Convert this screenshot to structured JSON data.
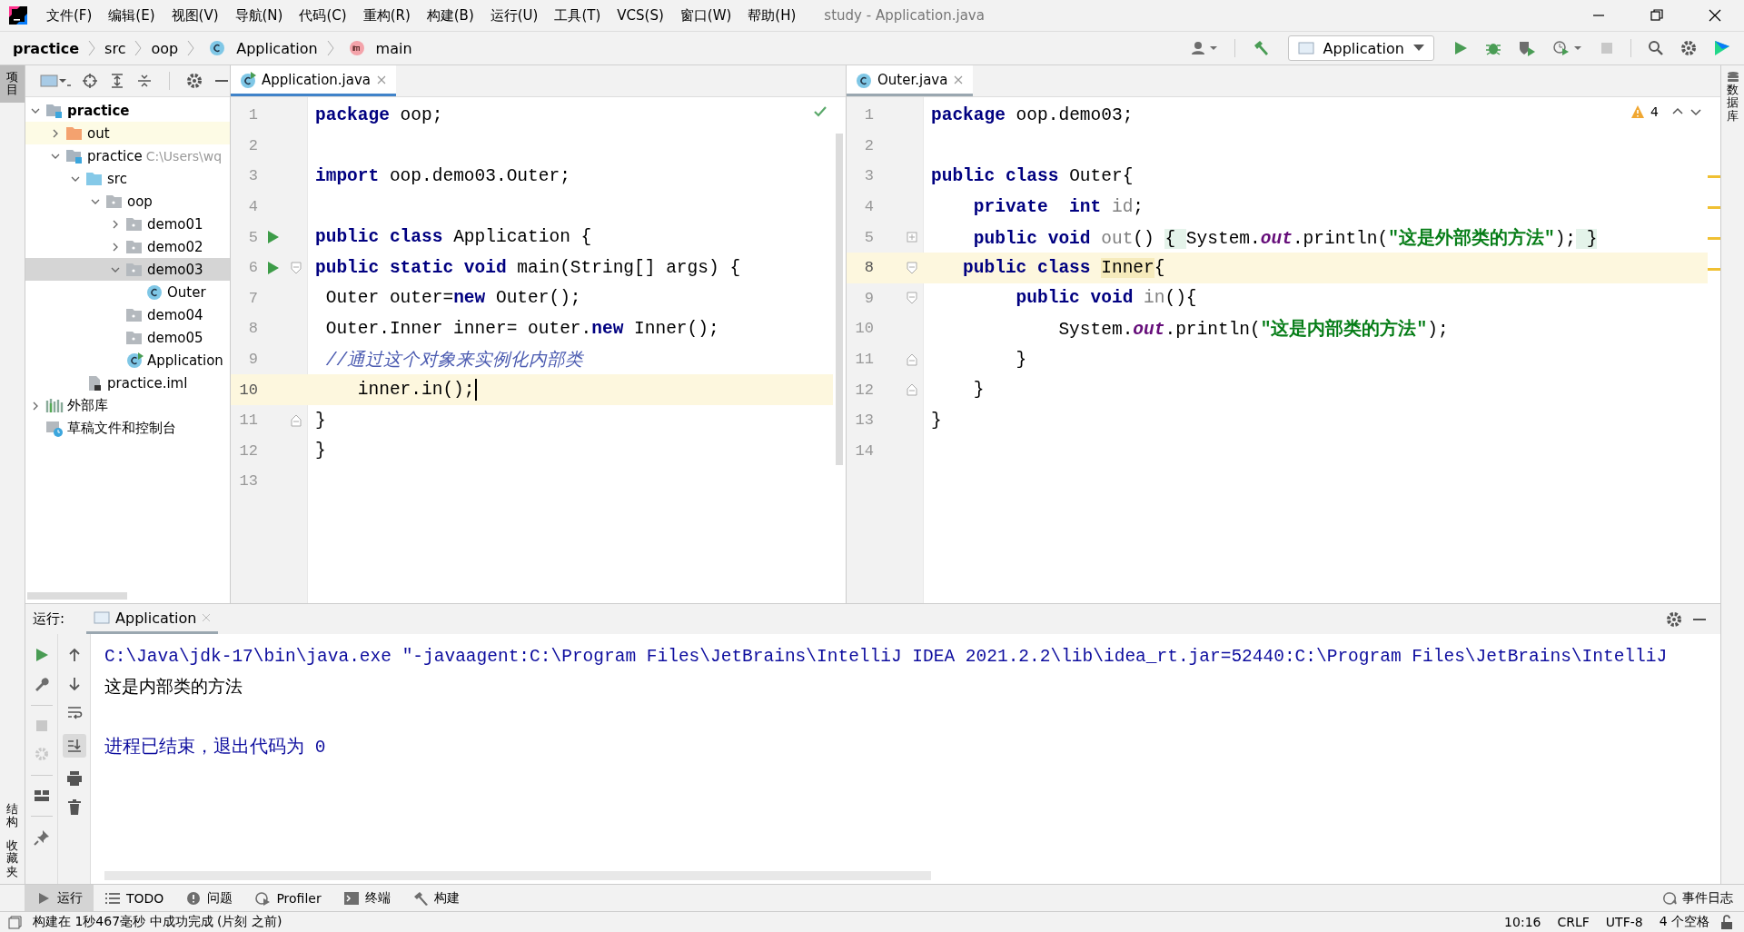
{
  "window": {
    "title": "study - Application.java"
  },
  "menu": [
    "文件(F)",
    "编辑(E)",
    "视图(V)",
    "导航(N)",
    "代码(C)",
    "重构(R)",
    "构建(B)",
    "运行(U)",
    "工具(T)",
    "VCS(S)",
    "窗口(W)",
    "帮助(H)"
  ],
  "breadcrumbs": [
    {
      "label": "practice",
      "kind": "project"
    },
    {
      "label": "src",
      "kind": "folder"
    },
    {
      "label": "oop",
      "kind": "folder"
    },
    {
      "label": "Application",
      "kind": "class"
    },
    {
      "label": "main",
      "kind": "method"
    }
  ],
  "run_config": {
    "label": "Application"
  },
  "left_stripe": [
    {
      "label": "项目",
      "selected": true
    },
    {
      "label": "结构",
      "selected": false
    },
    {
      "label": "收藏夹",
      "selected": false
    }
  ],
  "right_stripe": [
    {
      "label": "数据库",
      "selected": false
    }
  ],
  "project_tree": [
    {
      "label": "practice",
      "kind": "module",
      "bold": true,
      "expanded": true,
      "selected": false,
      "children": [
        {
          "label": "out",
          "kind": "excluded",
          "expanded": false,
          "selected": false
        },
        {
          "label": "practice",
          "hint": "C:\\Users\\wq",
          "kind": "module",
          "expanded": true,
          "selected": false,
          "children": [
            {
              "label": "src",
              "kind": "source",
              "expanded": true,
              "selected": false,
              "children": [
                {
                  "label": "oop",
                  "kind": "package",
                  "expanded": true,
                  "selected": false,
                  "children": [
                    {
                      "label": "demo01",
                      "kind": "package",
                      "expanded": false,
                      "selected": false
                    },
                    {
                      "label": "demo02",
                      "kind": "package",
                      "expanded": false,
                      "selected": false
                    },
                    {
                      "label": "demo03",
                      "kind": "package",
                      "expanded": true,
                      "selected": true,
                      "children": [
                        {
                          "label": "Outer",
                          "kind": "class",
                          "selected": false
                        }
                      ]
                    },
                    {
                      "label": "demo04",
                      "kind": "package",
                      "selected": false
                    },
                    {
                      "label": "demo05",
                      "kind": "package",
                      "selected": false
                    },
                    {
                      "label": "Application",
                      "kind": "runclass",
                      "selected": false
                    }
                  ]
                }
              ]
            },
            {
              "label": "practice.iml",
              "kind": "file",
              "selected": false
            }
          ]
        }
      ]
    },
    {
      "label": "外部库",
      "kind": "library",
      "expanded": false,
      "selected": false
    },
    {
      "label": "草稿文件和控制台",
      "kind": "scratch",
      "selected": false
    }
  ],
  "editors": [
    {
      "tab": "Application.java",
      "focused": true,
      "kind": "clean",
      "lines": [
        {
          "number": "1",
          "run": false,
          "current": false,
          "kind": "plain",
          "tokens": [
            {
              "kind": "keyword",
              "text": "package"
            },
            {
              "kind": "plain",
              "text": " oop;"
            }
          ]
        },
        {
          "number": "2",
          "run": false,
          "current": false,
          "kind": "plain"
        },
        {
          "number": "3",
          "run": false,
          "current": false,
          "kind": "plain",
          "tokens": [
            {
              "kind": "keyword",
              "text": "import"
            },
            {
              "kind": "plain",
              "text": " oop.demo03.Outer;"
            }
          ]
        },
        {
          "number": "4",
          "run": false,
          "current": false,
          "kind": "plain"
        },
        {
          "number": "5",
          "run": true,
          "current": false,
          "kind": "plain",
          "tokens": [
            {
              "kind": "keyword",
              "text": "public class"
            },
            {
              "kind": "plain",
              "text": " Application {"
            }
          ]
        },
        {
          "number": "6",
          "run": true,
          "current": false,
          "kind": "fold-open",
          "tokens": [
            {
              "kind": "keyword",
              "text": "public static void"
            },
            {
              "kind": "plain",
              "text": " main(String[] args) {"
            }
          ]
        },
        {
          "number": "7",
          "run": false,
          "current": false,
          "kind": "plain",
          "tokens": [
            {
              "kind": "plain",
              "text": " Outer outer="
            },
            {
              "kind": "keyword",
              "text": "new"
            },
            {
              "kind": "plain",
              "text": " Outer();"
            }
          ]
        },
        {
          "number": "8",
          "run": false,
          "current": false,
          "kind": "plain",
          "tokens": [
            {
              "kind": "plain",
              "text": " Outer.Inner inner= outer."
            },
            {
              "kind": "keyword",
              "text": "new"
            },
            {
              "kind": "plain",
              "text": " Inner();"
            }
          ]
        },
        {
          "number": "9",
          "run": false,
          "current": false,
          "kind": "plain",
          "tokens": [
            {
              "kind": "comment",
              "text": " //通过这个对象来实例化内部类"
            }
          ]
        },
        {
          "number": "10",
          "run": false,
          "current": true,
          "kind": "plain",
          "tokens": [
            {
              "kind": "plain",
              "text": "    inner.in();"
            }
          ]
        },
        {
          "number": "11",
          "run": false,
          "current": false,
          "kind": "fold-close",
          "tokens": [
            {
              "kind": "plain",
              "text": "}"
            }
          ]
        },
        {
          "number": "12",
          "run": false,
          "current": false,
          "kind": "plain",
          "tokens": [
            {
              "kind": "plain",
              "text": "}"
            }
          ]
        },
        {
          "number": "13",
          "run": false,
          "current": false,
          "kind": "plain"
        }
      ]
    },
    {
      "tab": "Outer.java",
      "focused": false,
      "kind": "warnings",
      "warnings": "4",
      "lines": [
        {
          "number": "1",
          "run": false,
          "current": false,
          "kind": "plain",
          "tokens": [
            {
              "kind": "keyword",
              "text": "package"
            },
            {
              "kind": "plain",
              "text": " oop.demo03;"
            }
          ]
        },
        {
          "number": "2",
          "run": false,
          "current": false,
          "kind": "plain"
        },
        {
          "number": "3",
          "run": false,
          "current": false,
          "kind": "plain",
          "tokens": [
            {
              "kind": "keyword",
              "text": "public class"
            },
            {
              "kind": "plain",
              "text": " Outer{"
            }
          ]
        },
        {
          "number": "4",
          "run": false,
          "current": false,
          "kind": "plain",
          "tokens": [
            {
              "kind": "keyword",
              "text": "    private  int "
            },
            {
              "kind": "dim",
              "text": "id"
            },
            {
              "kind": "plain",
              "text": ";"
            }
          ]
        },
        {
          "number": "5",
          "run": false,
          "current": false,
          "kind": "collapsed",
          "tokens": [
            {
              "kind": "keyword",
              "text": "    public void "
            },
            {
              "kind": "dim",
              "text": "out"
            },
            {
              "kind": "plain",
              "text": "() "
            },
            {
              "kind": "folded",
              "text": "{ "
            },
            {
              "kind": "plain",
              "text": "System."
            },
            {
              "kind": "field",
              "text": "out"
            },
            {
              "kind": "plain",
              "text": ".println("
            },
            {
              "kind": "string",
              "text": "\"这是外部类的方法\""
            },
            {
              "kind": "plain",
              "text": ");"
            },
            {
              "kind": "folded",
              "text": " }"
            }
          ]
        },
        {
          "number": "8",
          "run": false,
          "current": true,
          "kind": "fold-open",
          "tokens": [
            {
              "kind": "keyword",
              "text": "   public class "
            },
            {
              "kind": "match",
              "text": "Inner"
            },
            {
              "kind": "plain",
              "text": "{"
            }
          ]
        },
        {
          "number": "9",
          "run": false,
          "current": false,
          "kind": "fold-open",
          "tokens": [
            {
              "kind": "keyword",
              "text": "        public void "
            },
            {
              "kind": "dim",
              "text": "in"
            },
            {
              "kind": "plain",
              "text": "(){"
            }
          ]
        },
        {
          "number": "10",
          "run": false,
          "current": false,
          "kind": "plain",
          "tokens": [
            {
              "kind": "plain",
              "text": "            System."
            },
            {
              "kind": "field",
              "text": "out"
            },
            {
              "kind": "plain",
              "text": ".println("
            },
            {
              "kind": "string",
              "text": "\"这是内部类的方法\""
            },
            {
              "kind": "plain",
              "text": ");"
            }
          ]
        },
        {
          "number": "11",
          "run": false,
          "current": false,
          "kind": "fold-close",
          "tokens": [
            {
              "kind": "plain",
              "text": "        }"
            }
          ]
        },
        {
          "number": "12",
          "run": false,
          "current": false,
          "kind": "fold-close",
          "tokens": [
            {
              "kind": "plain",
              "text": "    }"
            }
          ]
        },
        {
          "number": "13",
          "run": false,
          "current": false,
          "kind": "plain",
          "tokens": [
            {
              "kind": "plain",
              "text": "}"
            }
          ]
        },
        {
          "number": "14",
          "run": false,
          "current": false,
          "kind": "plain"
        }
      ]
    }
  ],
  "run_panel": {
    "label": "运行:",
    "tab": "Application",
    "scroll_to_end": true,
    "console": [
      {
        "kind": "command",
        "text": "C:\\Java\\jdk-17\\bin\\java.exe \"-javaagent:C:\\Program Files\\JetBrains\\IntelliJ IDEA 2021.2.2\\lib\\idea_rt.jar=52440:C:\\Program Files\\JetBrains\\IntelliJ"
      },
      {
        "kind": "output",
        "text": "这是内部类的方法"
      },
      {
        "kind": "blank"
      },
      {
        "kind": "system",
        "text": "进程已结束，退出代码为 0"
      }
    ]
  },
  "tool_windows": [
    {
      "label": "运行",
      "kind": "run",
      "selected": true
    },
    {
      "label": "TODO",
      "kind": "todo",
      "selected": false
    },
    {
      "label": "问题",
      "kind": "problems",
      "selected": false
    },
    {
      "label": "Profiler",
      "kind": "profiler",
      "selected": false
    },
    {
      "label": "终端",
      "kind": "terminal",
      "selected": false
    },
    {
      "label": "构建",
      "kind": "build",
      "selected": false
    }
  ],
  "event_log": "事件日志",
  "status_bar": {
    "message": "构建在 1秒467毫秒 中成功完成 (片刻 之前)",
    "items": [
      "10:16",
      "CRLF",
      "UTF-8",
      "4 个空格"
    ]
  }
}
